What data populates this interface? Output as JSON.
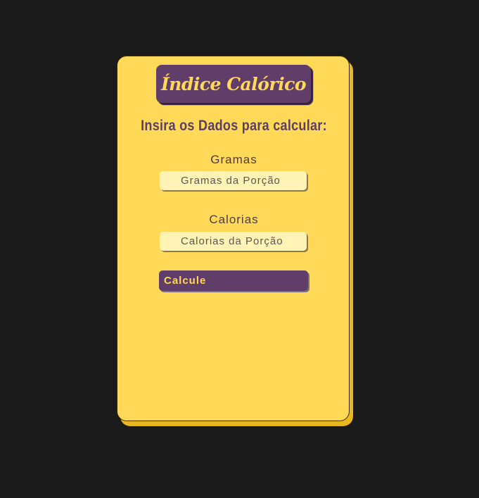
{
  "header": {
    "title": "Índice Calórico"
  },
  "form": {
    "instruction": "Insira os Dados para calcular:",
    "grams": {
      "label": "Gramas",
      "placeholder": "Gramas da Porção",
      "value": ""
    },
    "calories": {
      "label": "Calorias",
      "placeholder": "Calorias da Porção",
      "value": ""
    },
    "submit_label": "Calcule"
  },
  "colors": {
    "background": "#1a1a1a",
    "card": "#ffd957",
    "accent_purple": "#613d69",
    "input_bg": "#fff3b5"
  }
}
